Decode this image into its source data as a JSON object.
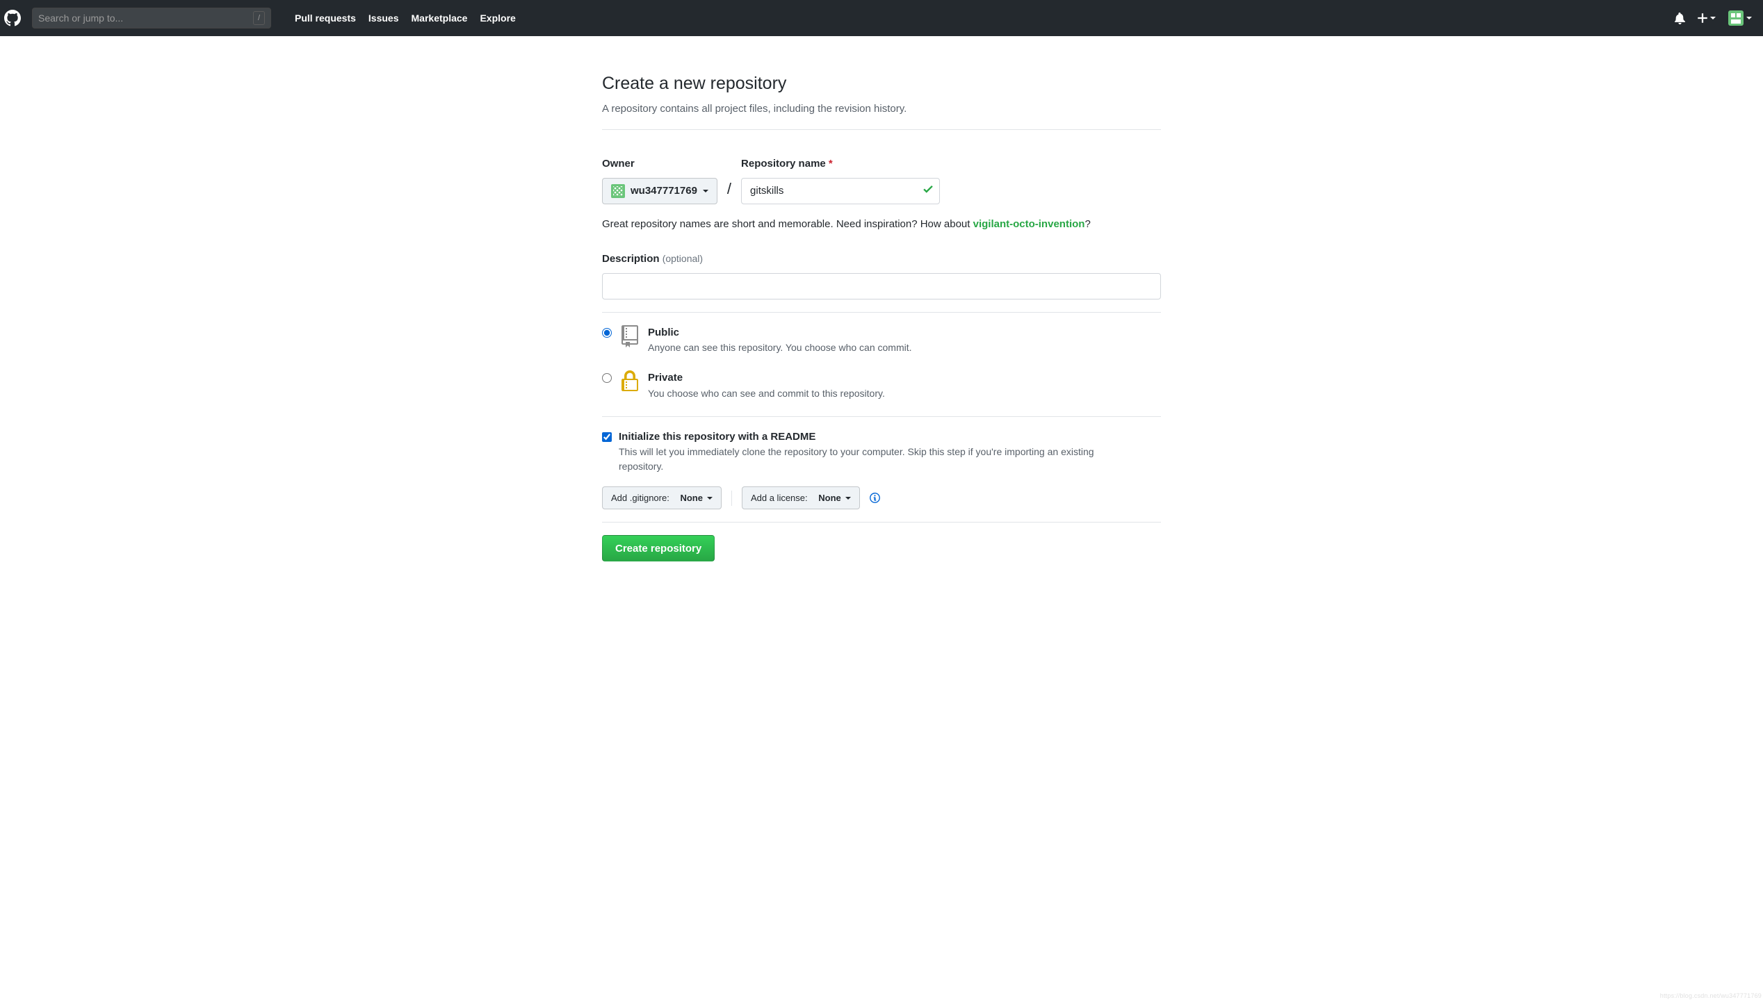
{
  "header": {
    "search_placeholder": "Search or jump to...",
    "slash_hint": "/",
    "nav": {
      "pull_requests": "Pull requests",
      "issues": "Issues",
      "marketplace": "Marketplace",
      "explore": "Explore"
    }
  },
  "page": {
    "title": "Create a new repository",
    "subtitle": "A repository contains all project files, including the revision history."
  },
  "form": {
    "owner_label": "Owner",
    "owner_value": "wu347771769",
    "repo_label": "Repository name",
    "repo_value": "gitskills",
    "slash": "/",
    "hint_prefix": "Great repository names are short and memorable. Need inspiration? How about ",
    "suggestion": "vigilant-octo-invention",
    "hint_suffix": "?",
    "desc_label": "Description",
    "optional": "(optional)",
    "desc_value": ""
  },
  "visibility": {
    "public": {
      "title": "Public",
      "sub": "Anyone can see this repository. You choose who can commit."
    },
    "private": {
      "title": "Private",
      "sub": "You choose who can see and commit to this repository."
    }
  },
  "init": {
    "title": "Initialize this repository with a README",
    "sub": "This will let you immediately clone the repository to your computer. Skip this step if you're importing an existing repository."
  },
  "aux": {
    "gitignore_label": "Add .gitignore:",
    "gitignore_value": "None",
    "license_label": "Add a license:",
    "license_value": "None"
  },
  "submit_label": "Create repository",
  "watermark": "https://blog.csdn.net/wu347771769"
}
